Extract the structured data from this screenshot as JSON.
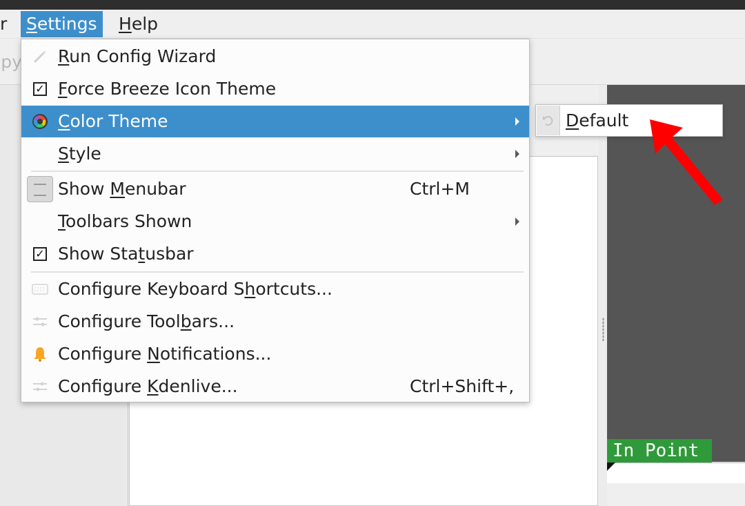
{
  "menubar": {
    "items": [
      {
        "pre": "",
        "u": "",
        "post": "r"
      },
      {
        "pre": "",
        "u": "S",
        "post": "ettings"
      },
      {
        "pre": "",
        "u": "H",
        "post": "elp"
      }
    ]
  },
  "toolbar": {
    "partial_label": "opy"
  },
  "settings_menu": {
    "items": [
      {
        "icon": "wand-icon",
        "pre": "",
        "u": "R",
        "post": "un Config Wizard",
        "shortcut": ""
      },
      {
        "icon": "checkbox-checked",
        "pre": "",
        "u": "F",
        "post": "orce Breeze Icon Theme",
        "shortcut": ""
      },
      {
        "icon": "color-wheel-icon",
        "pre": "",
        "u": "C",
        "post": "olor Theme",
        "shortcut": ""
      },
      {
        "icon": "",
        "pre": "",
        "u": "S",
        "post": "tyle",
        "shortcut": ""
      },
      {
        "icon": "menubar-icon",
        "pre": "Show ",
        "u": "M",
        "post": "enubar",
        "shortcut": "Ctrl+M"
      },
      {
        "icon": "",
        "pre": "",
        "u": "T",
        "post": "oolbars Shown",
        "shortcut": ""
      },
      {
        "icon": "checkbox-checked",
        "pre": "Show Sta",
        "u": "t",
        "post": "usbar",
        "shortcut": ""
      },
      {
        "icon": "keyboard-icon",
        "pre": "Configure Keyboard S",
        "u": "h",
        "post": "ortcuts...",
        "shortcut": ""
      },
      {
        "icon": "toolbars-icon",
        "pre": "Configure Tool",
        "u": "b",
        "post": "ars...",
        "shortcut": ""
      },
      {
        "icon": "bell-icon",
        "pre": "Configure ",
        "u": "N",
        "post": "otifications...",
        "shortcut": ""
      },
      {
        "icon": "configure-icon",
        "pre": "Configure ",
        "u": "K",
        "post": "denlive...",
        "shortcut": "Ctrl+Shift+,"
      }
    ],
    "check_glyph": "✓"
  },
  "color_theme_submenu": {
    "items": [
      {
        "icon": "undo-icon",
        "pre": "",
        "u": "D",
        "post": "efault"
      }
    ]
  },
  "monitor": {
    "in_point_label": "In Point"
  },
  "colors": {
    "highlight": "#3d8fcc",
    "annotation_arrow": "#ff0000",
    "in_point_bg": "#2f9a3a"
  }
}
